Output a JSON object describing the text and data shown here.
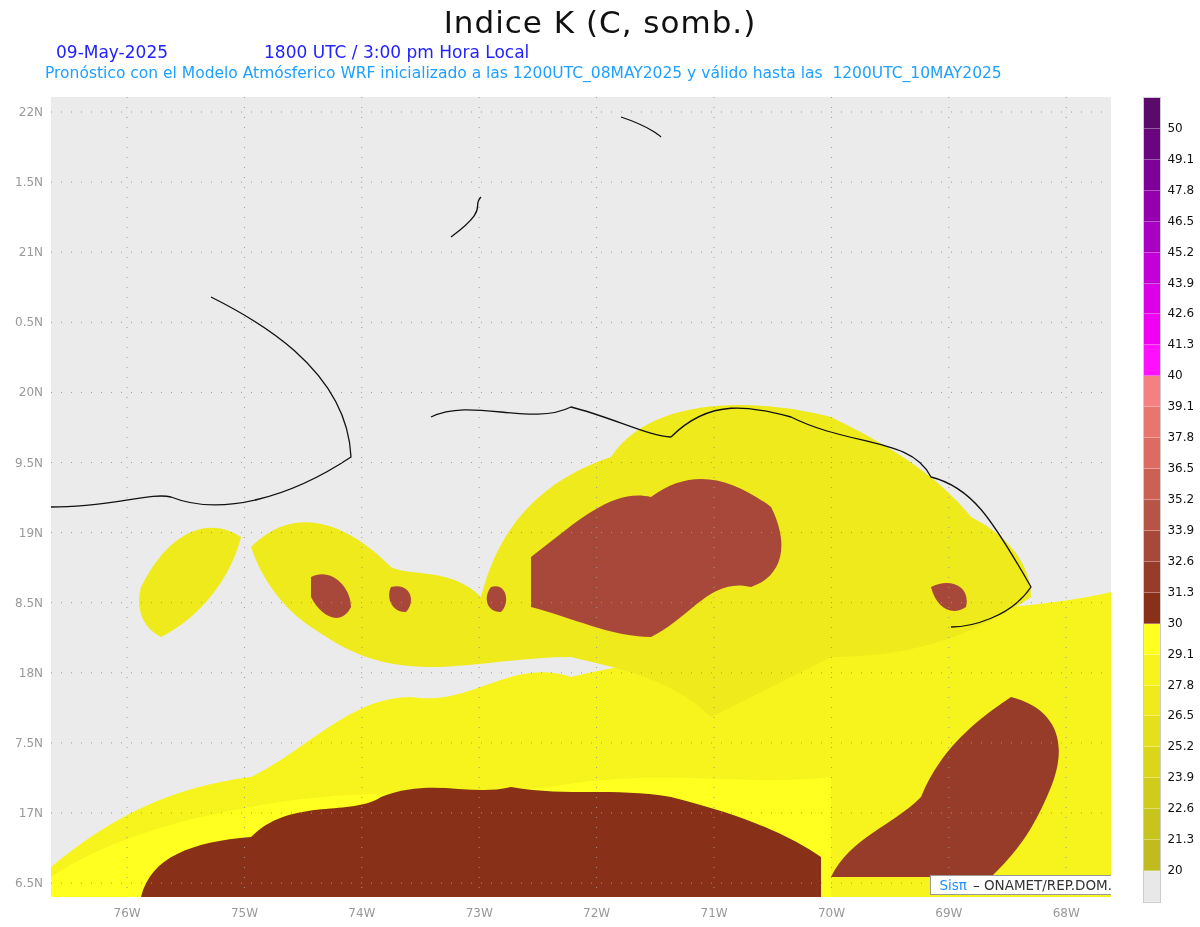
{
  "title": "Indice K (C, somb.)",
  "date": "09-May-2025",
  "time": "1800 UTC / 3:00 pm Hora Local",
  "subtitle": "Pronóstico con el Modelo Atmósferico WRF inicializado a las 1200UTC_08MAY2025 y válido hasta las  1200UTC_10MAY2025",
  "y_axis": [
    "22N",
    "1.5N",
    "21N",
    "0.5N",
    "20N",
    "9.5N",
    "19N",
    "8.5N",
    "18N",
    "7.5N",
    "17N",
    "6.5N"
  ],
  "x_axis": [
    "76W",
    "75W",
    "74W",
    "73W",
    "72W",
    "71W",
    "70W",
    "69W",
    "68W"
  ],
  "colorbar": {
    "labels": [
      "50",
      "49.1",
      "47.8",
      "46.5",
      "45.2",
      "43.9",
      "42.6",
      "41.3",
      "40",
      "39.1",
      "37.8",
      "36.5",
      "35.2",
      "33.9",
      "32.6",
      "31.3",
      "30",
      "29.1",
      "27.8",
      "26.5",
      "25.2",
      "23.9",
      "22.6",
      "21.3",
      "20"
    ],
    "bins": [
      {
        "color": "#5a0a6a"
      },
      {
        "color": "#6a0580"
      },
      {
        "color": "#7e0098"
      },
      {
        "color": "#9400ae"
      },
      {
        "color": "#aa00c4"
      },
      {
        "color": "#c400d8"
      },
      {
        "color": "#dc00e8"
      },
      {
        "color": "#f000f4"
      },
      {
        "color": "#ff10ff"
      },
      {
        "color": "#f48080"
      },
      {
        "color": "#e8766e"
      },
      {
        "color": "#dc6c62"
      },
      {
        "color": "#cc6052"
      },
      {
        "color": "#b85446"
      },
      {
        "color": "#a8483a"
      },
      {
        "color": "#983c2a"
      },
      {
        "color": "#883018"
      },
      {
        "color": "#ffff20"
      },
      {
        "color": "#f6f41c"
      },
      {
        "color": "#eeea1c"
      },
      {
        "color": "#e4e01c"
      },
      {
        "color": "#dad61c"
      },
      {
        "color": "#d0cc1c"
      },
      {
        "color": "#c8c41e"
      },
      {
        "color": "#c0bc20"
      },
      {
        "color": "#e8e8e8"
      }
    ]
  },
  "credit": {
    "brand": "Sisπ",
    "text": "– ONAMET/REP.DOM."
  }
}
